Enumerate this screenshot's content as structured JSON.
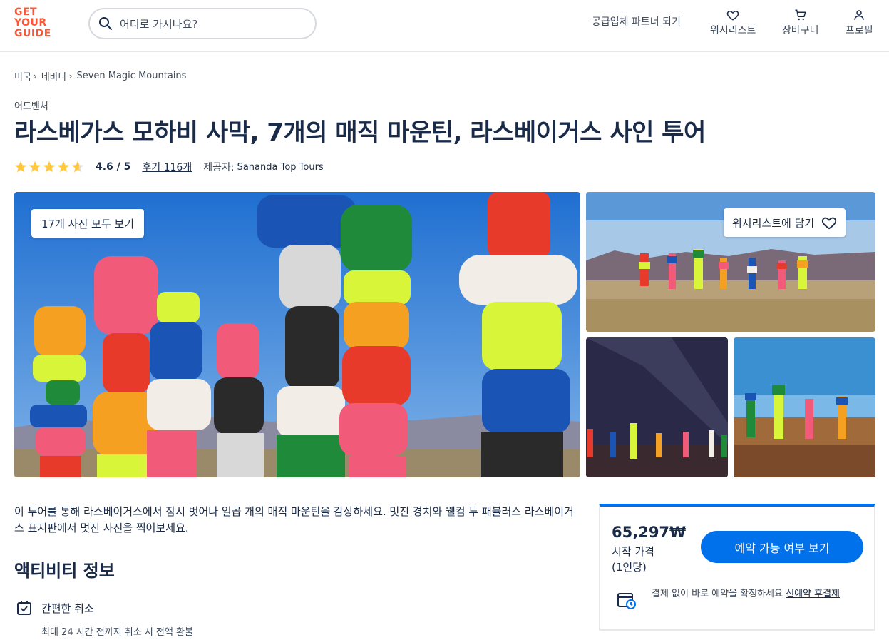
{
  "header": {
    "logo_lines": [
      "GET",
      "YOUR",
      "GUIDE"
    ],
    "search_placeholder": "어디로 가시나요?",
    "partner_link": "공급업체 파트너 되기",
    "nav": {
      "wishlist": "위시리스트",
      "cart": "장바구니",
      "profile": "프로필"
    }
  },
  "breadcrumb": [
    "미국",
    "네바다",
    "Seven Magic Mountains"
  ],
  "activity": {
    "category": "어드벤처",
    "title": "라스베가스 모하비 사막, 7개의 매직 마운틴, 라스베이거스 사인 투어",
    "rating_stars": 4.6,
    "rating_text": "4.6 / 5",
    "reviews": "후기 116개",
    "provider_label": "제공자:",
    "provider": "Sananda Top Tours"
  },
  "gallery": {
    "all_photos": "17개 사진 모두 보기",
    "wishlist_add": "위시리스트에 담기"
  },
  "description": "이 투어를 통해 라스베이거스에서 잠시 벗어나 일곱 개의 매직 마운틴을 감상하세요. 멋진 경치와 웰컴 투 패뷸러스 라스베이거스 표지판에서 멋진 사진을 찍어보세요.",
  "info": {
    "section_title": "액티비티 정보",
    "cancel_title": "간편한 취소",
    "cancel_sub": "최대 24 시간 전까지 취소 시 전액 환불"
  },
  "booking": {
    "price": "65,297₩",
    "price_from": "시작 가격",
    "per_person": "(1인당)",
    "check_button": "예약 가능 여부 보기",
    "reserve_text": "결제 없이 바로 예약을 확정하세요 ",
    "reserve_link": "선예약 후결제"
  },
  "colors": {
    "brand": "#ff5533",
    "primary": "#0071eb",
    "text": "#1a2b49",
    "star": "#ffc83d"
  }
}
